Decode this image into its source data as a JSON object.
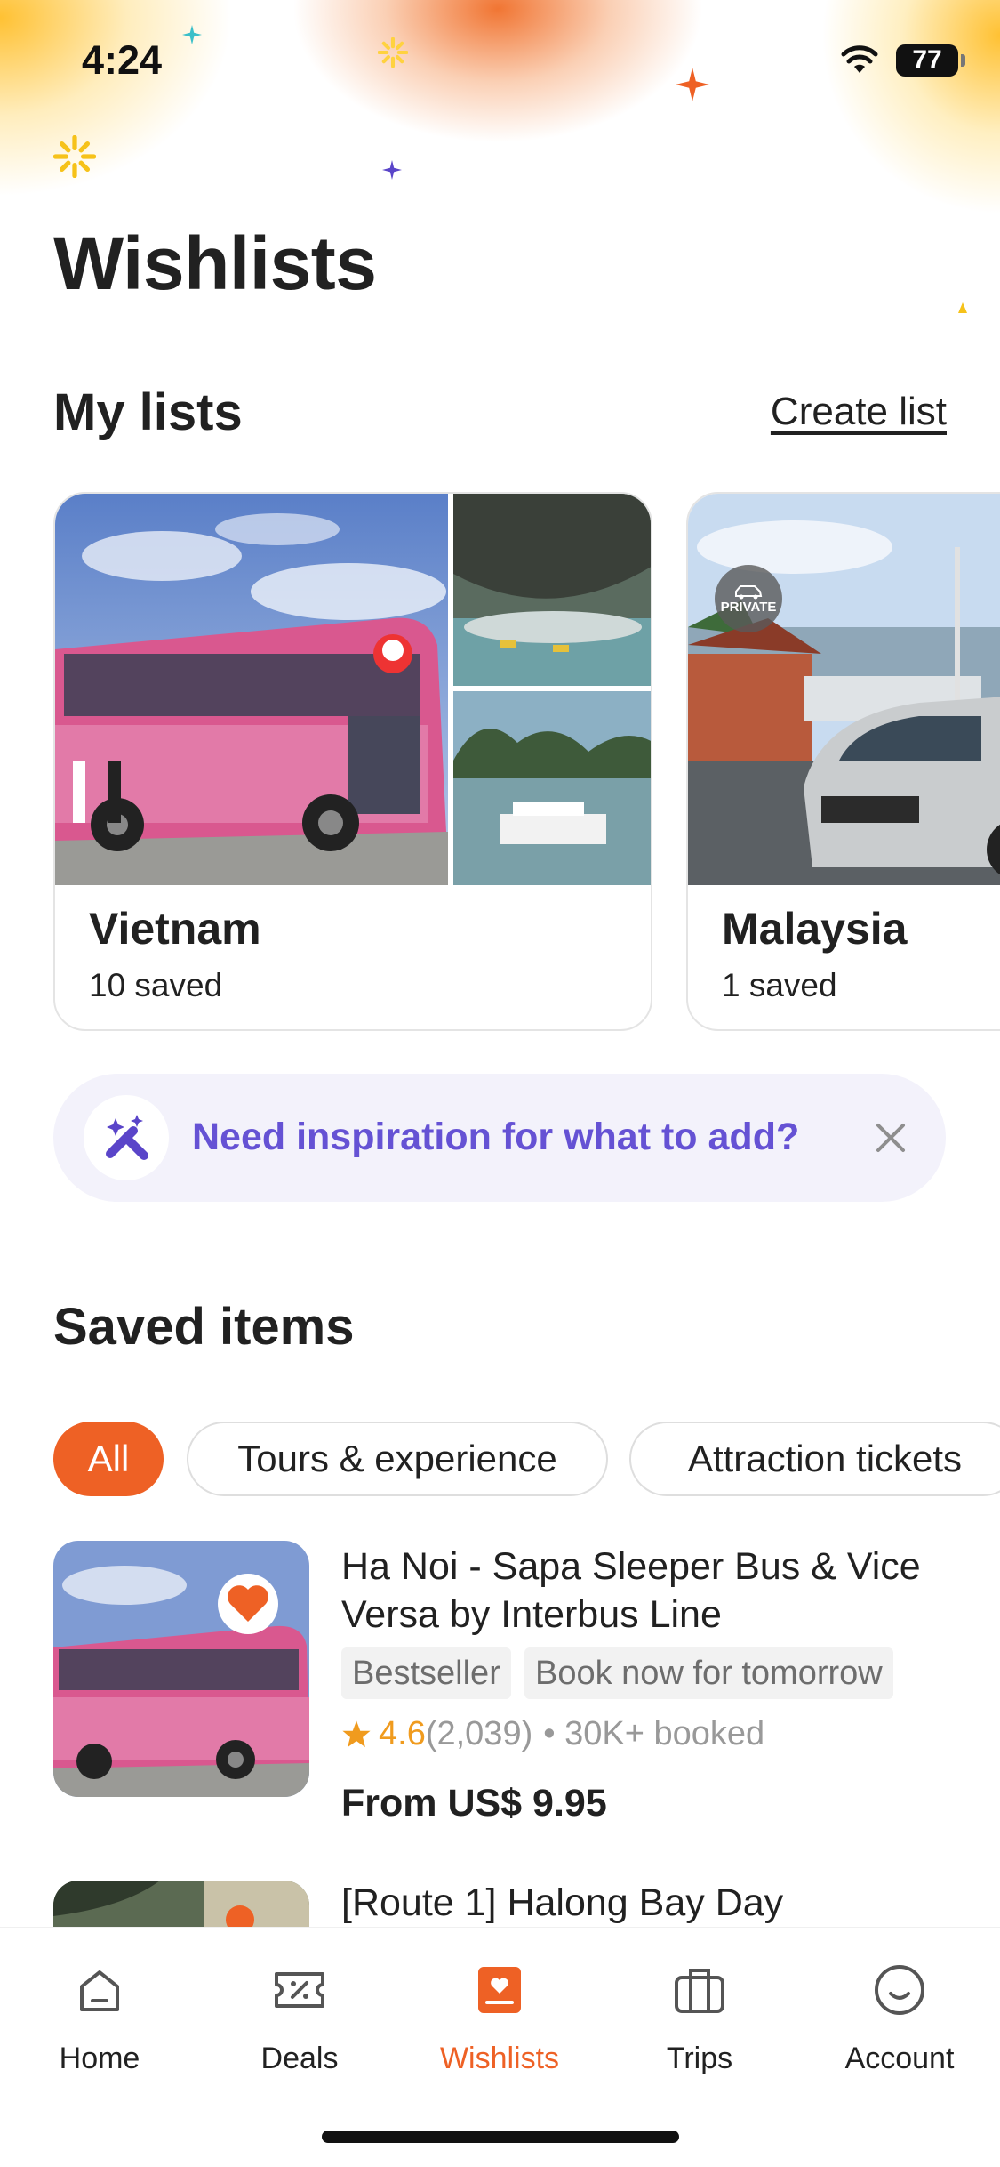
{
  "status_bar": {
    "time": "4:24",
    "battery": "77"
  },
  "page": {
    "title": "Wishlists"
  },
  "my_lists": {
    "title": "My lists",
    "create_label": "Create list",
    "lists": [
      {
        "name": "Vietnam",
        "count": "10 saved"
      },
      {
        "name": "Malaysia",
        "count": "1 saved",
        "badge": "PRIVATE"
      }
    ]
  },
  "inspiration": {
    "text": "Need inspiration for what to add?"
  },
  "saved_items": {
    "title": "Saved items",
    "filters": [
      "All",
      "Tours & experience",
      "Attraction tickets"
    ],
    "active_filter": "All",
    "items": [
      {
        "title": "Ha Noi - Sapa Sleeper Bus & Vice Versa by Interbus Line",
        "tags": [
          "Bestseller",
          "Book now for tomorrow"
        ],
        "rating": "4.6",
        "reviews": "(2,039)",
        "booked": "• 30K+ booked",
        "price": "From US$ 9.95",
        "favorited": true
      },
      {
        "title": "[Route 1] Halong Bay Day"
      }
    ]
  },
  "bottom_nav": {
    "items": [
      {
        "label": "Home",
        "icon": "home-icon"
      },
      {
        "label": "Deals",
        "icon": "deals-icon"
      },
      {
        "label": "Wishlists",
        "icon": "wishlists-icon"
      },
      {
        "label": "Trips",
        "icon": "trips-icon"
      },
      {
        "label": "Account",
        "icon": "account-icon"
      }
    ],
    "active": "Wishlists"
  },
  "colors": {
    "accent": "#ee6125",
    "inspiration_text": "#6552d4",
    "inspiration_bg": "#f3f2fb",
    "rating": "#f09b1e"
  }
}
